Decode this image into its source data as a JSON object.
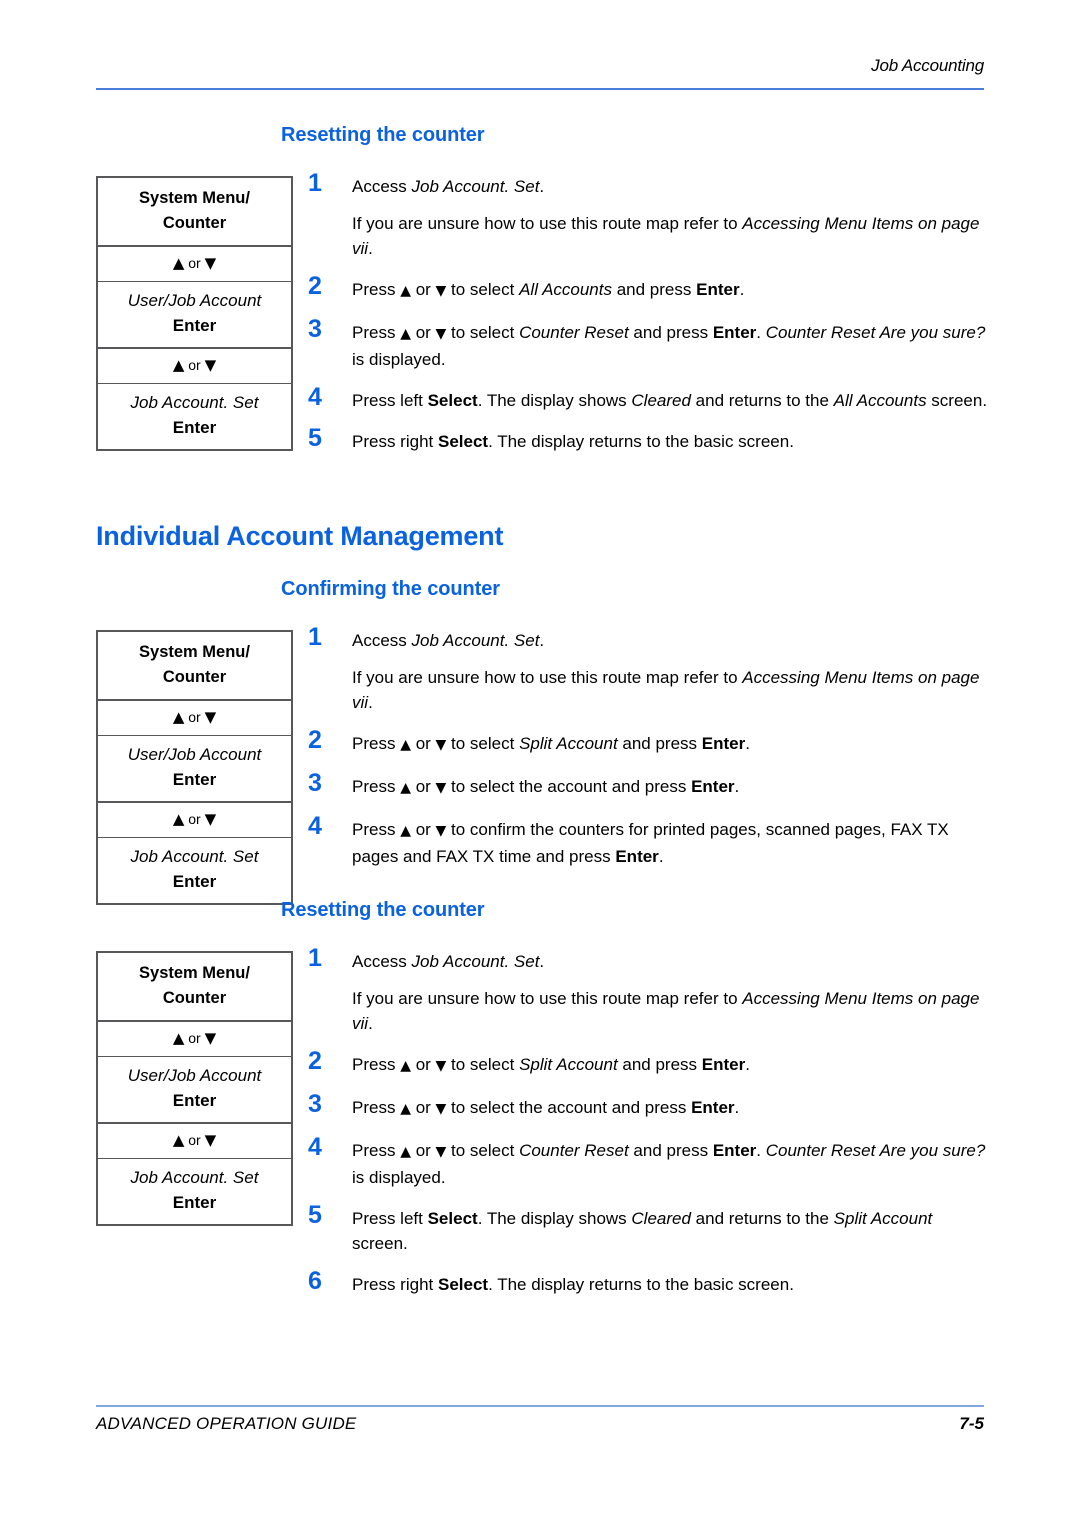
{
  "header": {
    "title": "Job Accounting"
  },
  "footer": {
    "guide": "ADVANCED OPERATION GUIDE",
    "page_number": "7-5"
  },
  "colors": {
    "heading_blue": "#0a62e0",
    "rule_blue": "#4a7ddb",
    "footer_rule_blue": "#7fa6e3",
    "box_border": "#58585a"
  },
  "glyphs": {
    "up_arrow": "▲",
    "down_arrow": "▼",
    "or": "or"
  },
  "route_map": {
    "key_line1": "System Menu/",
    "key_line2": "Counter",
    "arrow_row": "▲ or ▼",
    "menu1_item": "User/Job Account",
    "menu1_key": "Enter",
    "menu2_item": "Job Account. Set",
    "menu2_key": "Enter"
  },
  "sections": [
    {
      "id": "all-accounts-resetting",
      "heading": "Resetting the counter",
      "heading_level": "h2",
      "steps": [
        {
          "num": "1",
          "paragraphs": [
            [
              {
                "t": "Access ",
                "s": "n"
              },
              {
                "t": "Job Account. Set",
                "s": "i"
              },
              {
                "t": ".",
                "s": "n"
              }
            ],
            [
              {
                "t": "If you are unsure how to use this route map refer to ",
                "s": "n"
              },
              {
                "t": "Accessing Menu Items on page vii",
                "s": "i"
              },
              {
                "t": ".",
                "s": "n"
              }
            ]
          ]
        },
        {
          "num": "2",
          "paragraphs": [
            [
              {
                "t": "Press ",
                "s": "n"
              },
              {
                "t": "▲",
                "s": "tri"
              },
              {
                "t": " or ",
                "s": "n"
              },
              {
                "t": "▼",
                "s": "tri"
              },
              {
                "t": " to select ",
                "s": "n"
              },
              {
                "t": "All Accounts",
                "s": "i"
              },
              {
                "t": " and press ",
                "s": "n"
              },
              {
                "t": "Enter",
                "s": "b"
              },
              {
                "t": ".",
                "s": "n"
              }
            ]
          ]
        },
        {
          "num": "3",
          "paragraphs": [
            [
              {
                "t": "Press ",
                "s": "n"
              },
              {
                "t": "▲",
                "s": "tri"
              },
              {
                "t": " or ",
                "s": "n"
              },
              {
                "t": "▼",
                "s": "tri"
              },
              {
                "t": " to select ",
                "s": "n"
              },
              {
                "t": "Counter Reset",
                "s": "i"
              },
              {
                "t": " and press ",
                "s": "n"
              },
              {
                "t": "Enter",
                "s": "b"
              },
              {
                "t": ". ",
                "s": "n"
              },
              {
                "t": "Counter Reset Are you sure?",
                "s": "i"
              },
              {
                "t": " is displayed.",
                "s": "n"
              }
            ]
          ]
        },
        {
          "num": "4",
          "paragraphs": [
            [
              {
                "t": "Press left ",
                "s": "n"
              },
              {
                "t": "Select",
                "s": "b"
              },
              {
                "t": ". The display shows ",
                "s": "n"
              },
              {
                "t": "Cleared",
                "s": "i"
              },
              {
                "t": " and returns to the ",
                "s": "n"
              },
              {
                "t": "All Accounts",
                "s": "i"
              },
              {
                "t": " screen.",
                "s": "n"
              }
            ]
          ]
        },
        {
          "num": "5",
          "paragraphs": [
            [
              {
                "t": "Press right ",
                "s": "n"
              },
              {
                "t": "Select",
                "s": "b"
              },
              {
                "t": ". The display returns to the basic screen.",
                "s": "n"
              }
            ]
          ]
        }
      ]
    },
    {
      "id": "individual-account-management",
      "heading": "Individual Account Management",
      "heading_level": "h1"
    },
    {
      "id": "split-confirming",
      "heading": "Confirming the counter",
      "heading_level": "h2",
      "steps": [
        {
          "num": "1",
          "paragraphs": [
            [
              {
                "t": "Access ",
                "s": "n"
              },
              {
                "t": "Job Account. Set",
                "s": "i"
              },
              {
                "t": ".",
                "s": "n"
              }
            ],
            [
              {
                "t": "If you are unsure how to use this route map refer to ",
                "s": "n"
              },
              {
                "t": "Accessing Menu Items on page vii",
                "s": "i"
              },
              {
                "t": ".",
                "s": "n"
              }
            ]
          ]
        },
        {
          "num": "2",
          "paragraphs": [
            [
              {
                "t": "Press ",
                "s": "n"
              },
              {
                "t": "▲",
                "s": "tri"
              },
              {
                "t": " or ",
                "s": "n"
              },
              {
                "t": "▼",
                "s": "tri"
              },
              {
                "t": " to select ",
                "s": "n"
              },
              {
                "t": "Split Account",
                "s": "i"
              },
              {
                "t": " and press ",
                "s": "n"
              },
              {
                "t": "Enter",
                "s": "b"
              },
              {
                "t": ".",
                "s": "n"
              }
            ]
          ]
        },
        {
          "num": "3",
          "paragraphs": [
            [
              {
                "t": "Press ",
                "s": "n"
              },
              {
                "t": "▲",
                "s": "tri"
              },
              {
                "t": " or ",
                "s": "n"
              },
              {
                "t": "▼",
                "s": "tri"
              },
              {
                "t": " to select the account and press ",
                "s": "n"
              },
              {
                "t": "Enter",
                "s": "b"
              },
              {
                "t": ".",
                "s": "n"
              }
            ]
          ]
        },
        {
          "num": "4",
          "paragraphs": [
            [
              {
                "t": "Press ",
                "s": "n"
              },
              {
                "t": "▲",
                "s": "tri"
              },
              {
                "t": " or ",
                "s": "n"
              },
              {
                "t": "▼",
                "s": "tri"
              },
              {
                "t": " to confirm the counters for printed pages, scanned pages, FAX TX pages and FAX TX time and press ",
                "s": "n"
              },
              {
                "t": "Enter",
                "s": "b"
              },
              {
                "t": ".",
                "s": "n"
              }
            ]
          ]
        }
      ]
    },
    {
      "id": "split-resetting",
      "heading": "Resetting the counter",
      "heading_level": "h2",
      "steps": [
        {
          "num": "1",
          "paragraphs": [
            [
              {
                "t": "Access ",
                "s": "n"
              },
              {
                "t": "Job Account. Set",
                "s": "i"
              },
              {
                "t": ".",
                "s": "n"
              }
            ],
            [
              {
                "t": "If you are unsure how to use this route map refer to ",
                "s": "n"
              },
              {
                "t": "Accessing Menu Items on page vii",
                "s": "i"
              },
              {
                "t": ".",
                "s": "n"
              }
            ]
          ]
        },
        {
          "num": "2",
          "paragraphs": [
            [
              {
                "t": "Press ",
                "s": "n"
              },
              {
                "t": "▲",
                "s": "tri"
              },
              {
                "t": " or ",
                "s": "n"
              },
              {
                "t": "▼",
                "s": "tri"
              },
              {
                "t": " to select ",
                "s": "n"
              },
              {
                "t": "Split Account",
                "s": "i"
              },
              {
                "t": " and press ",
                "s": "n"
              },
              {
                "t": "Enter",
                "s": "b"
              },
              {
                "t": ".",
                "s": "n"
              }
            ]
          ]
        },
        {
          "num": "3",
          "paragraphs": [
            [
              {
                "t": "Press ",
                "s": "n"
              },
              {
                "t": "▲",
                "s": "tri"
              },
              {
                "t": " or ",
                "s": "n"
              },
              {
                "t": "▼",
                "s": "tri"
              },
              {
                "t": " to select the account and press ",
                "s": "n"
              },
              {
                "t": "Enter",
                "s": "b"
              },
              {
                "t": ".",
                "s": "n"
              }
            ]
          ]
        },
        {
          "num": "4",
          "paragraphs": [
            [
              {
                "t": "Press ",
                "s": "n"
              },
              {
                "t": "▲",
                "s": "tri"
              },
              {
                "t": " or ",
                "s": "n"
              },
              {
                "t": "▼",
                "s": "tri"
              },
              {
                "t": " to select ",
                "s": "n"
              },
              {
                "t": "Counter Reset",
                "s": "i"
              },
              {
                "t": " and press ",
                "s": "n"
              },
              {
                "t": "Enter",
                "s": "b"
              },
              {
                "t": ". ",
                "s": "n"
              },
              {
                "t": "Counter Reset Are you sure?",
                "s": "i"
              },
              {
                "t": " is displayed.",
                "s": "n"
              }
            ]
          ]
        },
        {
          "num": "5",
          "paragraphs": [
            [
              {
                "t": "Press left ",
                "s": "n"
              },
              {
                "t": "Select",
                "s": "b"
              },
              {
                "t": ". The display shows ",
                "s": "n"
              },
              {
                "t": "Cleared",
                "s": "i"
              },
              {
                "t": " and returns to the ",
                "s": "n"
              },
              {
                "t": "Split Account",
                "s": "i"
              },
              {
                "t": " screen.",
                "s": "n"
              }
            ]
          ]
        },
        {
          "num": "6",
          "paragraphs": [
            [
              {
                "t": "Press right ",
                "s": "n"
              },
              {
                "t": "Select",
                "s": "b"
              },
              {
                "t": ". The display returns to the basic screen.",
                "s": "n"
              }
            ]
          ]
        }
      ]
    }
  ]
}
